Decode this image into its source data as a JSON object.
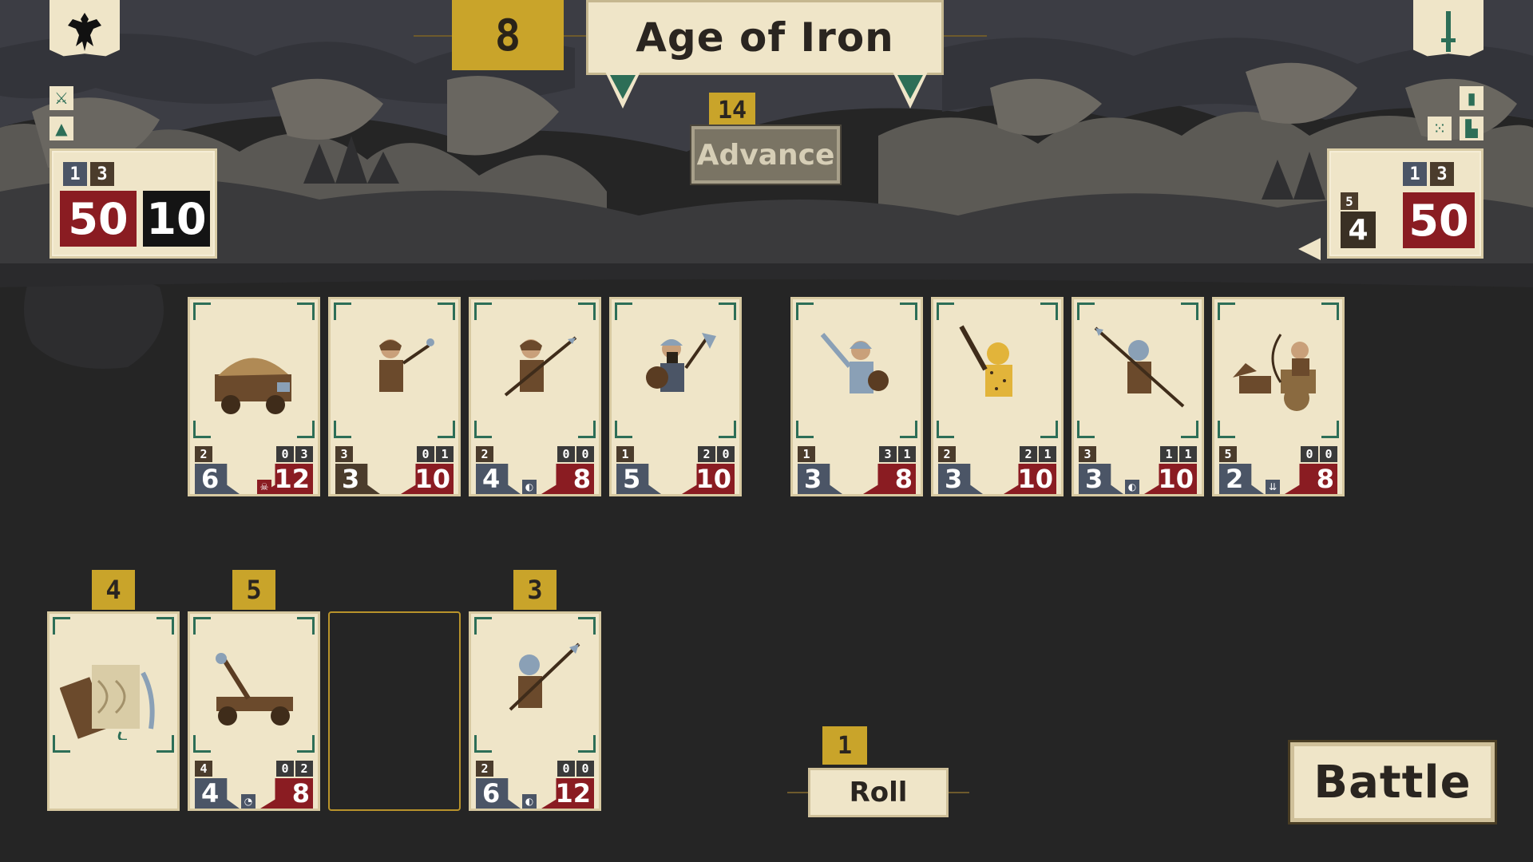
{
  "era": {
    "number": "8",
    "title": "Age of Iron"
  },
  "advance": {
    "count": "14",
    "label": "Advance"
  },
  "player": {
    "chip_a": "1",
    "chip_b": "3",
    "life": "50",
    "gold": "10"
  },
  "opponent": {
    "chip_a": "1",
    "chip_b": "3",
    "small_tier": "5",
    "small_value": "4",
    "life": "50"
  },
  "player_board": [
    {
      "name": "supply-wagon",
      "tier": "2",
      "m1": "0",
      "m2": "3",
      "atk": "6",
      "hp": "12",
      "perk": "skull-icon"
    },
    {
      "name": "slinger",
      "tier": "3",
      "m1": "0",
      "m2": "1",
      "atk": "3",
      "hp": "10",
      "perk": ""
    },
    {
      "name": "spearman",
      "tier": "2",
      "m1": "0",
      "m2": "0",
      "atk": "4",
      "hp": "8",
      "perk": "shield-icon"
    },
    {
      "name": "axeman",
      "tier": "1",
      "m1": "2",
      "m2": "0",
      "atk": "5",
      "hp": "10",
      "perk": ""
    }
  ],
  "enemy_board": [
    {
      "name": "swordsman",
      "tier": "1",
      "m1": "3",
      "m2": "1",
      "atk": "3",
      "hp": "8",
      "perk": ""
    },
    {
      "name": "leopard-warrior",
      "tier": "2",
      "m1": "2",
      "m2": "1",
      "atk": "3",
      "hp": "10",
      "perk": ""
    },
    {
      "name": "hoplite",
      "tier": "3",
      "m1": "1",
      "m2": "1",
      "atk": "3",
      "hp": "10",
      "perk": "shield-icon"
    },
    {
      "name": "chariot-archer",
      "tier": "5",
      "m1": "0",
      "m2": "0",
      "atk": "2",
      "hp": "8",
      "perk": "arrows-icon"
    }
  ],
  "shop": [
    {
      "name": "scroll-item",
      "cost": "4"
    },
    {
      "name": "catapult",
      "cost": "5",
      "tier": "4",
      "m1": "0",
      "m2": "2",
      "atk": "4",
      "hp": "8",
      "perk": "horn-icon"
    },
    {
      "name": "empty-slot"
    },
    {
      "name": "spear-guard",
      "cost": "3",
      "tier": "2",
      "m1": "0",
      "m2": "0",
      "atk": "6",
      "hp": "12",
      "perk": "shield-icon"
    }
  ],
  "roll": {
    "count": "1",
    "label": "Roll"
  },
  "battle": {
    "label": "Battle"
  },
  "colors": {
    "background": "#252525",
    "parchment": "#efe5c8",
    "gold": "#c9a42a",
    "red": "#8a1c22",
    "green": "#2d6e57"
  }
}
